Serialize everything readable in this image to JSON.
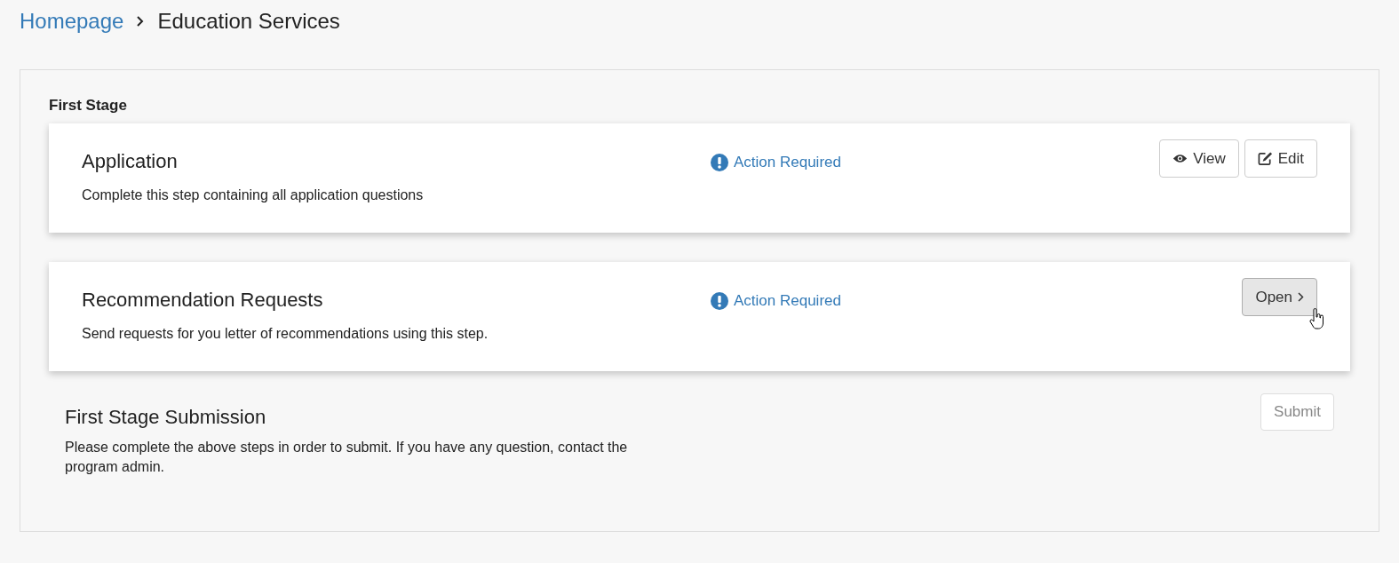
{
  "breadcrumb": {
    "items": [
      {
        "label": "Homepage",
        "kind": "link"
      },
      {
        "label": "Education Services",
        "kind": "current"
      }
    ]
  },
  "stage": {
    "title": "First Stage",
    "steps": [
      {
        "title": "Application",
        "description": "Complete this step containing all application questions",
        "status": "Action Required",
        "buttons": [
          {
            "label": "View",
            "kind": "view",
            "hovered": false
          },
          {
            "label": "Edit",
            "kind": "edit",
            "hovered": false
          }
        ]
      },
      {
        "title": "Recommendation Requests",
        "description": "Send requests for you letter of recommendations using this step.",
        "status": "Action Required",
        "buttons": [
          {
            "label": "Open",
            "kind": "open",
            "hovered": true
          }
        ]
      }
    ],
    "submission": {
      "title": "First Stage Submission",
      "description": "Please complete the above steps in order to submit. If you have any question, contact the program admin.",
      "button": {
        "label": "Submit",
        "disabled": true
      }
    }
  }
}
